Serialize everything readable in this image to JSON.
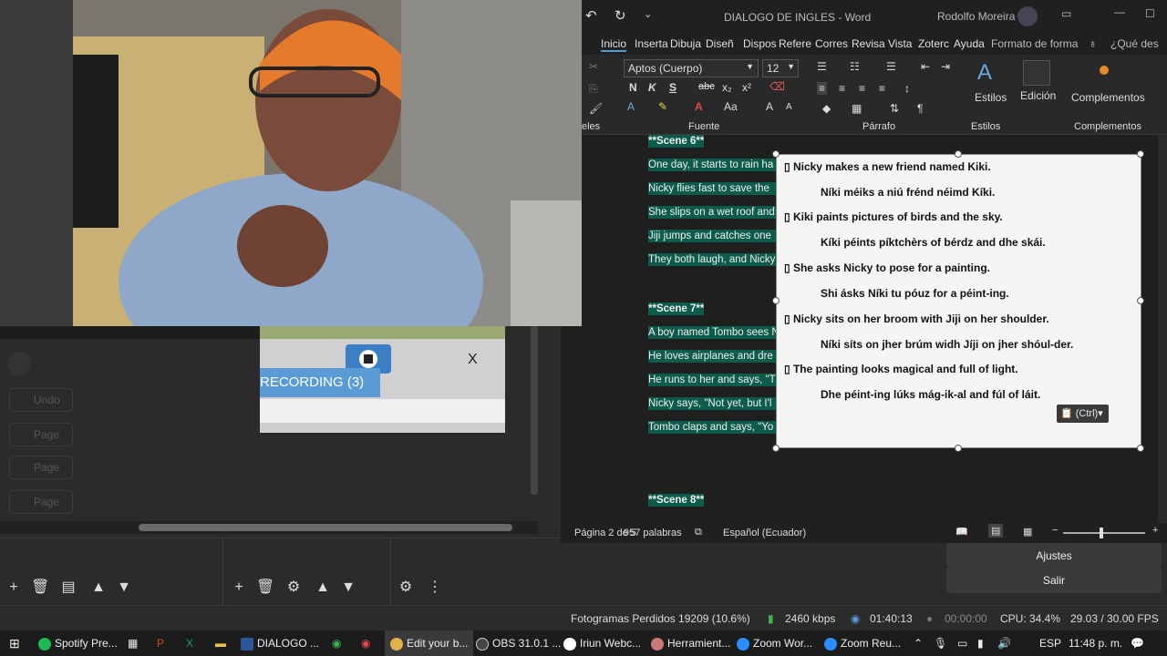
{
  "obs": {
    "dock_buttons": [
      "Undo",
      "Page",
      "Page",
      "Page"
    ],
    "recording_label": "RECORDING (3)",
    "close_label": "X",
    "settings_label": "Ajustes",
    "exit_label": "Salir",
    "status": {
      "dropped_frames": "Fotogramas Perdidos 19209 (10.6%)",
      "bitrate": "2460 kbps",
      "rec_time": "01:40:13",
      "stream_time": "00:00:00",
      "cpu": "CPU: 34.4%",
      "fps": "29.03 / 30.00 FPS"
    }
  },
  "word": {
    "title": "DIALOGO DE INGLES  -  Word",
    "user": "Rodolfo Moreira",
    "tabs": [
      "Inicio",
      "Inserta",
      "Dibuja",
      "Diseñ",
      "Dispos",
      "Refere",
      "Corres",
      "Revisa",
      "Vista",
      "Zoterc",
      "Ayuda",
      "Formato de forma",
      "¿Qué des"
    ],
    "ribbon": {
      "font_name": "Aptos (Cuerpo)",
      "font_size": "12",
      "group_font": "Fuente",
      "group_paragraph": "Párrafo",
      "group_styles": "Estilos",
      "group_addins": "Complementos",
      "group_left": "eles",
      "styles_btn": "Estilos",
      "edit_btn": "Edición",
      "addins_btn": "Complementos"
    },
    "doc_lines": [
      "**Scene 6**",
      "One day, it starts to rain ha",
      "Nicky flies fast to save the",
      "She slips on a wet roof and",
      "Jiji jumps and catches one",
      "They both laugh, and Nicky",
      "**Scene 7**",
      "A boy named Tombo sees N",
      "He loves airplanes and dre",
      "He runs to her and says, \"T",
      "Nicky says, \"Not yet, but I'l",
      "Tombo claps and says, \"Yo",
      "**Scene 8**"
    ],
    "textbox": [
      "Nicky makes a new friend named Kiki.",
      "Níki méiks a niú frénd néimd Kíki.",
      "Kiki paints pictures of birds and the sky.",
      "Kíki péints píktchèrs of bérdz and dhe skái.",
      "She asks Nicky to pose for a painting.",
      "Shi ásks Níki tu póuz for a péint-ing.",
      "Nicky sits on her broom with Jiji on her shoulder.",
      "Níki síts on jher brúm widh Jíji on jher shóul-der.",
      "The painting looks magical and full of light.",
      "Dhe péint-ing lúks mág-ik-al and fúl of láit."
    ],
    "paste_options": "(Ctrl)",
    "status": {
      "page": "Página 2 de 5",
      "words": "957 palabras",
      "language": "Español (Ecuador)"
    }
  },
  "taskbar": {
    "items": [
      "Spotify Pre...",
      "DIALOGO ...",
      "Edit your b...",
      "OBS 31.0.1 ...",
      "Iriun Webc...",
      "Herramient...",
      "Zoom Wor...",
      "Zoom Reu..."
    ],
    "lang": "ESP",
    "time": "11:48 p. m."
  }
}
